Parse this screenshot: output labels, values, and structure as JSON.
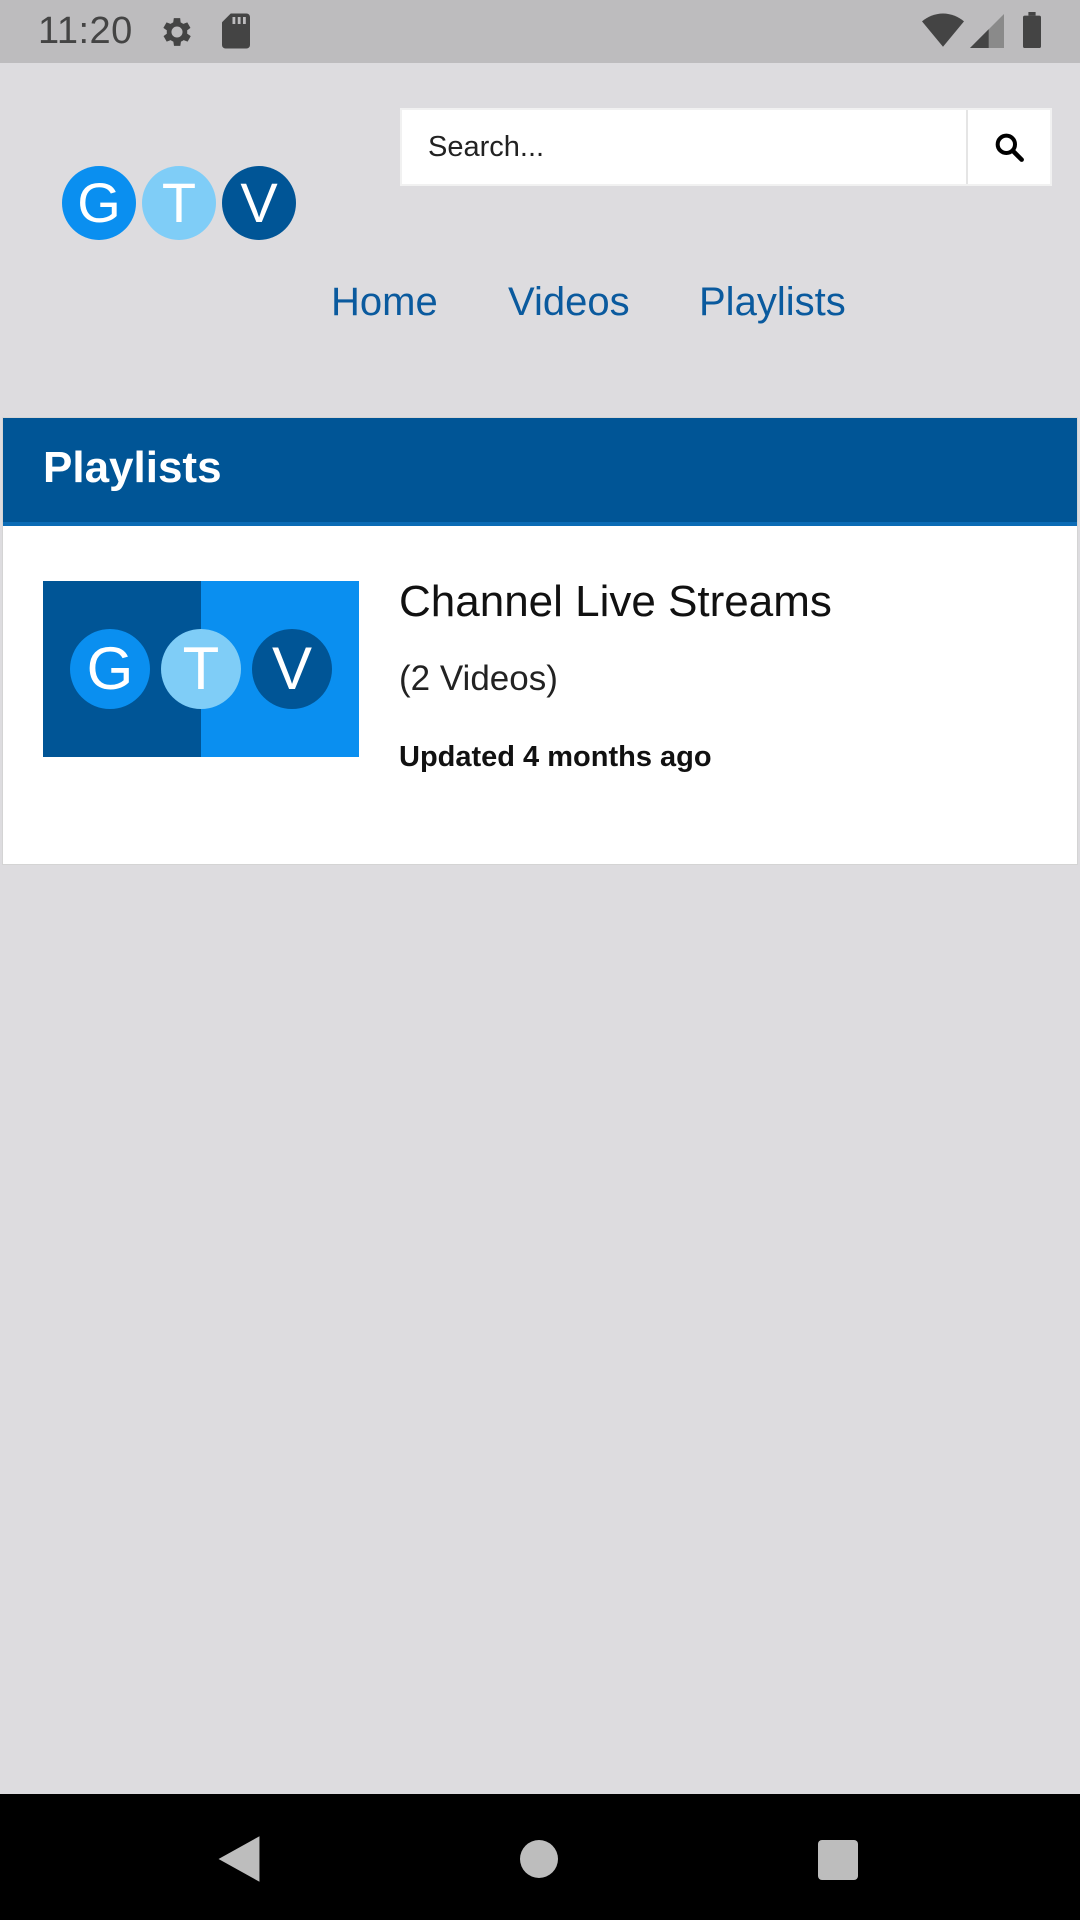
{
  "status_bar": {
    "time": "11:20",
    "icons": [
      "gear-icon",
      "sd-card-icon",
      "wifi-icon",
      "cell-signal-icon",
      "battery-icon"
    ]
  },
  "header": {
    "logo_letters": [
      "G",
      "T",
      "V"
    ],
    "logo_colors": [
      "#0a8ff0",
      "#7fcdf7",
      "#005596"
    ],
    "search": {
      "placeholder": "Search...",
      "value": "",
      "button_icon": "search-icon"
    },
    "nav": [
      {
        "label": "Home"
      },
      {
        "label": "Videos"
      },
      {
        "label": "Playlists"
      }
    ]
  },
  "section": {
    "title": "Playlists",
    "items": [
      {
        "thumb_letters": [
          "G",
          "T",
          "V"
        ],
        "title": "Channel Live Streams",
        "count": "(2 Videos)",
        "updated": "Updated 4 months ago"
      }
    ]
  },
  "colors": {
    "accent": "#005596",
    "link": "#0a5a9e",
    "background": "#dddcdf"
  },
  "system_nav": {
    "icons": [
      "back-icon",
      "home-icon",
      "recents-icon"
    ]
  }
}
